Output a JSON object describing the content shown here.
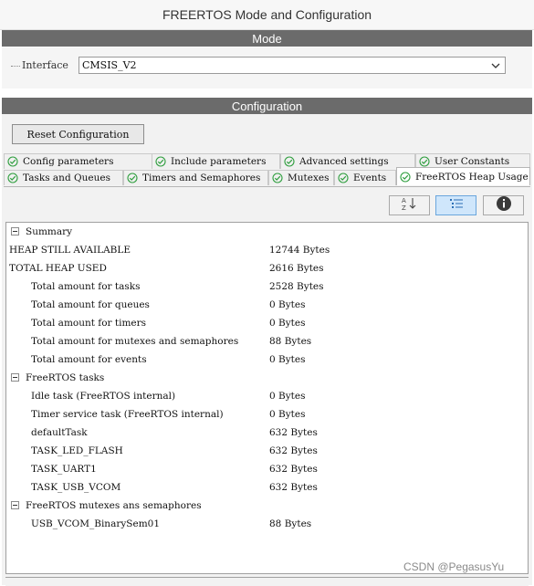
{
  "window_title": "FREERTOS Mode and Configuration",
  "mode_section": {
    "title": "Mode",
    "interface_label": "Interface",
    "interface_value": "CMSIS_V2"
  },
  "config_section": {
    "title": "Configuration",
    "reset_button": "Reset Configuration"
  },
  "tabs_row1": [
    {
      "label": "Config parameters"
    },
    {
      "label": "Include parameters"
    },
    {
      "label": "Advanced settings"
    },
    {
      "label": "User Constants"
    }
  ],
  "tabs_row2": [
    {
      "label": "Tasks and Queues"
    },
    {
      "label": "Timers and Semaphores"
    },
    {
      "label": "Mutexes"
    },
    {
      "label": "Events"
    },
    {
      "label": "FreeRTOS Heap Usage",
      "active": true
    }
  ],
  "toolbar": {
    "sort_icon": "sort-az-icon",
    "categories_icon": "list-icon",
    "info_icon": "info-icon"
  },
  "tree": [
    {
      "type": "group",
      "name": "Summary"
    },
    {
      "type": "row",
      "level": 0,
      "name": "HEAP STILL AVAILABLE",
      "value": "12744  Bytes"
    },
    {
      "type": "row",
      "level": 0,
      "name": "TOTAL HEAP USED",
      "value": "2616  Bytes"
    },
    {
      "type": "row",
      "level": 1,
      "name": "Total amount for tasks",
      "value": "2528  Bytes"
    },
    {
      "type": "row",
      "level": 1,
      "name": "Total amount for queues",
      "value": "0  Bytes"
    },
    {
      "type": "row",
      "level": 1,
      "name": "Total amount for timers",
      "value": "0  Bytes"
    },
    {
      "type": "row",
      "level": 1,
      "name": "Total amount for mutexes and semaphores",
      "value": "88  Bytes"
    },
    {
      "type": "row",
      "level": 1,
      "name": "Total amount for events",
      "value": "0  Bytes"
    },
    {
      "type": "group",
      "name": "FreeRTOS tasks"
    },
    {
      "type": "row",
      "level": 1,
      "name": "Idle task (FreeRTOS internal)",
      "value": "0  Bytes"
    },
    {
      "type": "row",
      "level": 1,
      "name": "Timer service task (FreeRTOS internal)",
      "value": "0  Bytes"
    },
    {
      "type": "row",
      "level": 1,
      "name": "defaultTask",
      "value": "632  Bytes"
    },
    {
      "type": "row",
      "level": 1,
      "name": "TASK_LED_FLASH",
      "value": "632  Bytes"
    },
    {
      "type": "row",
      "level": 1,
      "name": "TASK_UART1",
      "value": "632  Bytes"
    },
    {
      "type": "row",
      "level": 1,
      "name": "TASK_USB_VCOM",
      "value": "632  Bytes"
    },
    {
      "type": "group",
      "name": "FreeRTOS mutexes ans semaphores"
    },
    {
      "type": "row",
      "level": 1,
      "name": "USB_VCOM_BinarySem01",
      "value": "88  Bytes"
    }
  ],
  "watermark": "CSDN @PegasusYu",
  "colors": {
    "section_bar": "#6b6b6b",
    "check_green": "#2e9e3e",
    "pressed_button": "#cfe6fb",
    "info_icon": "#3a3a3a"
  }
}
